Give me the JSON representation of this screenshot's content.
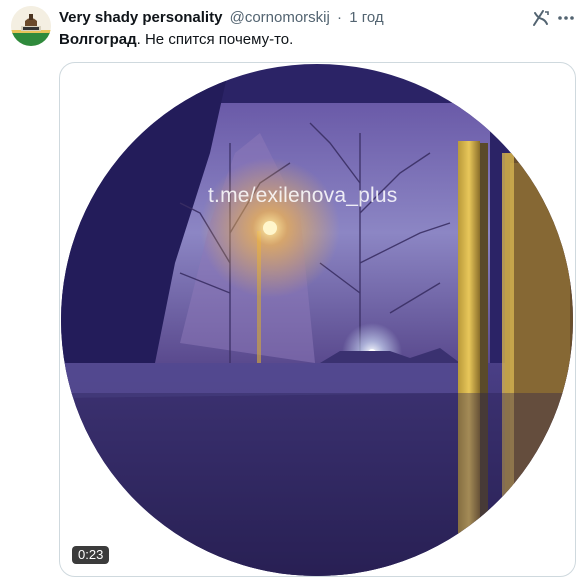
{
  "tweet": {
    "display_name": "Very shady personality",
    "handle": "@cornomorskij",
    "separator": "·",
    "time": "1 год",
    "text_bold": "Волгоград",
    "text_rest": ". Не спится почему-то."
  },
  "media": {
    "watermark": "t.me/exilenova_plus",
    "duration": "0:23"
  },
  "icons": {
    "grok": "grok-icon",
    "more": "more-icon",
    "avatar": "avatar-icon"
  },
  "colors": {
    "secondary_text": "#536471",
    "primary_text": "#0f1419",
    "border": "#cfd9de"
  }
}
